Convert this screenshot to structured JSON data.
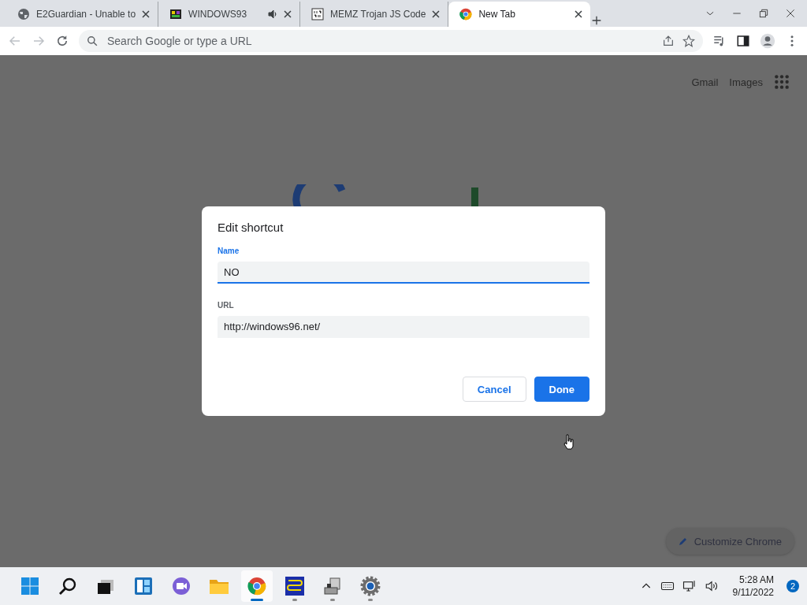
{
  "tabs": [
    {
      "title": "E2Guardian - Unable to",
      "audio": false,
      "selected": false
    },
    {
      "title": "WINDOWS93",
      "audio": true,
      "selected": false
    },
    {
      "title": "MEMZ Trojan JS Code",
      "audio": false,
      "selected": false
    },
    {
      "title": "New Tab",
      "audio": false,
      "selected": true
    }
  ],
  "omnibox": {
    "placeholder": "Search Google or type a URL"
  },
  "header_links": [
    "Gmail",
    "Images"
  ],
  "customize": {
    "label": "Customize Chrome"
  },
  "dialog": {
    "title": "Edit shortcut",
    "fields": [
      {
        "label": "Name",
        "value": "NO",
        "focused": true
      },
      {
        "label": "URL",
        "value": "http://windows96.net/",
        "focused": false
      }
    ],
    "buttons": [
      {
        "label": "Cancel",
        "kind": "secondary"
      },
      {
        "label": "Done",
        "kind": "primary"
      }
    ]
  },
  "taskbar": {
    "apps": [
      {
        "running": false,
        "selected": false
      },
      {
        "running": false,
        "selected": false
      },
      {
        "running": false,
        "selected": false
      },
      {
        "running": false,
        "selected": false
      },
      {
        "running": false,
        "selected": false
      },
      {
        "running": false,
        "selected": false
      },
      {
        "running": true,
        "selected": true
      },
      {
        "running": true,
        "selected": false
      },
      {
        "running": true,
        "selected": false
      },
      {
        "running": true,
        "selected": false
      }
    ],
    "time": "5:28 AM",
    "date": "9/11/2022",
    "notifications": "2"
  }
}
